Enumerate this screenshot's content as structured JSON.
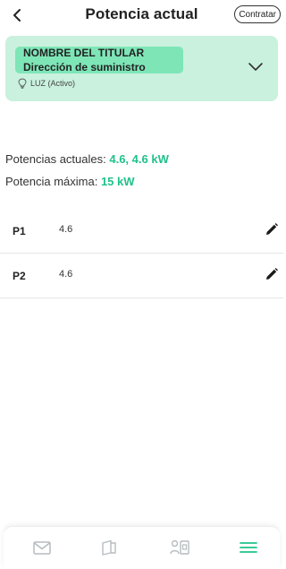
{
  "header": {
    "title": "Potencia actual",
    "contratar_label": "Contratar",
    "back_icon": "chevron-left-icon"
  },
  "supply": {
    "holder": "NOMBRE DEL TITULAR",
    "address": "Dirección de suministro",
    "status": "LUZ (Activo)",
    "status_icon": "lightbulb-icon",
    "expand_icon": "chevron-down-icon"
  },
  "power": {
    "current_label": "Potencias actuales:",
    "current_value": "4.6, 4.6 kW",
    "max_label": "Potencia máxima:",
    "max_value": "15 kW"
  },
  "periods": [
    {
      "label": "P1",
      "value": "4.6",
      "action_icon": "pencil-icon"
    },
    {
      "label": "P2",
      "value": "4.6",
      "action_icon": "pencil-icon"
    }
  ],
  "nav": {
    "items": [
      {
        "icon": "mail-icon",
        "active": false
      },
      {
        "icon": "invoice-icon",
        "active": false
      },
      {
        "icon": "profile-card-icon",
        "active": false
      },
      {
        "icon": "menu-icon",
        "active": true
      }
    ]
  },
  "colors": {
    "accent": "#1fc28a",
    "card_bg": "#c9f1de",
    "highlight": "#7ee5b7",
    "nav_inactive": "#b5bcc0"
  }
}
